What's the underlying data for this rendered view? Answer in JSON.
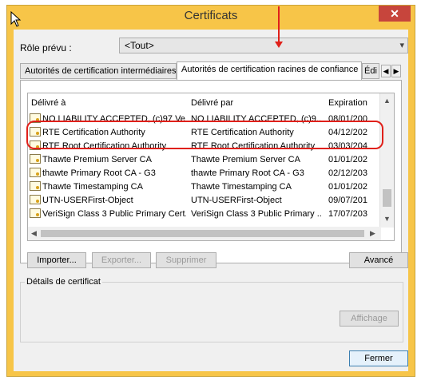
{
  "window": {
    "title": "Certificats",
    "close_label": "✕"
  },
  "role": {
    "label": "Rôle prévu :",
    "value": "<Tout>"
  },
  "tabs": [
    {
      "label": "Autorités de certification intermédiaires"
    },
    {
      "label": "Autorités de certification racines de confiance"
    },
    {
      "label": "Édi"
    }
  ],
  "columns": [
    "Délivré à",
    "Délivré par",
    "Expiration"
  ],
  "rows": [
    {
      "to": "NO LIABILITY ACCEPTED, (c)97 Ve...",
      "by": "NO LIABILITY ACCEPTED, (c)9...",
      "exp": "08/01/200"
    },
    {
      "to": "RTE Certification Authority",
      "by": "RTE Certification Authority",
      "exp": "04/12/202"
    },
    {
      "to": "RTE Root Certification Authority",
      "by": "RTE Root Certification Authority",
      "exp": "03/03/204"
    },
    {
      "to": "Thawte Premium Server CA",
      "by": "Thawte Premium Server CA",
      "exp": "01/01/202"
    },
    {
      "to": "thawte Primary Root CA - G3",
      "by": "thawte Primary Root CA - G3",
      "exp": "02/12/203"
    },
    {
      "to": "Thawte Timestamping CA",
      "by": "Thawte Timestamping CA",
      "exp": "01/01/202"
    },
    {
      "to": "UTN-USERFirst-Object",
      "by": "UTN-USERFirst-Object",
      "exp": "09/07/201"
    },
    {
      "to": "VeriSign Class 3 Public Primary Cert...",
      "by": "VeriSign Class 3 Public Primary ...",
      "exp": "17/07/203"
    }
  ],
  "buttons": {
    "import": "Importer...",
    "export": "Exporter...",
    "remove": "Supprimer",
    "advanced": "Avancé",
    "view": "Affichage",
    "close": "Fermer"
  },
  "details": {
    "label": "Détails de certificat"
  },
  "colors": {
    "window_frame": "#f7c548",
    "highlight": "#e0201a",
    "close_button": "#c7453c"
  }
}
